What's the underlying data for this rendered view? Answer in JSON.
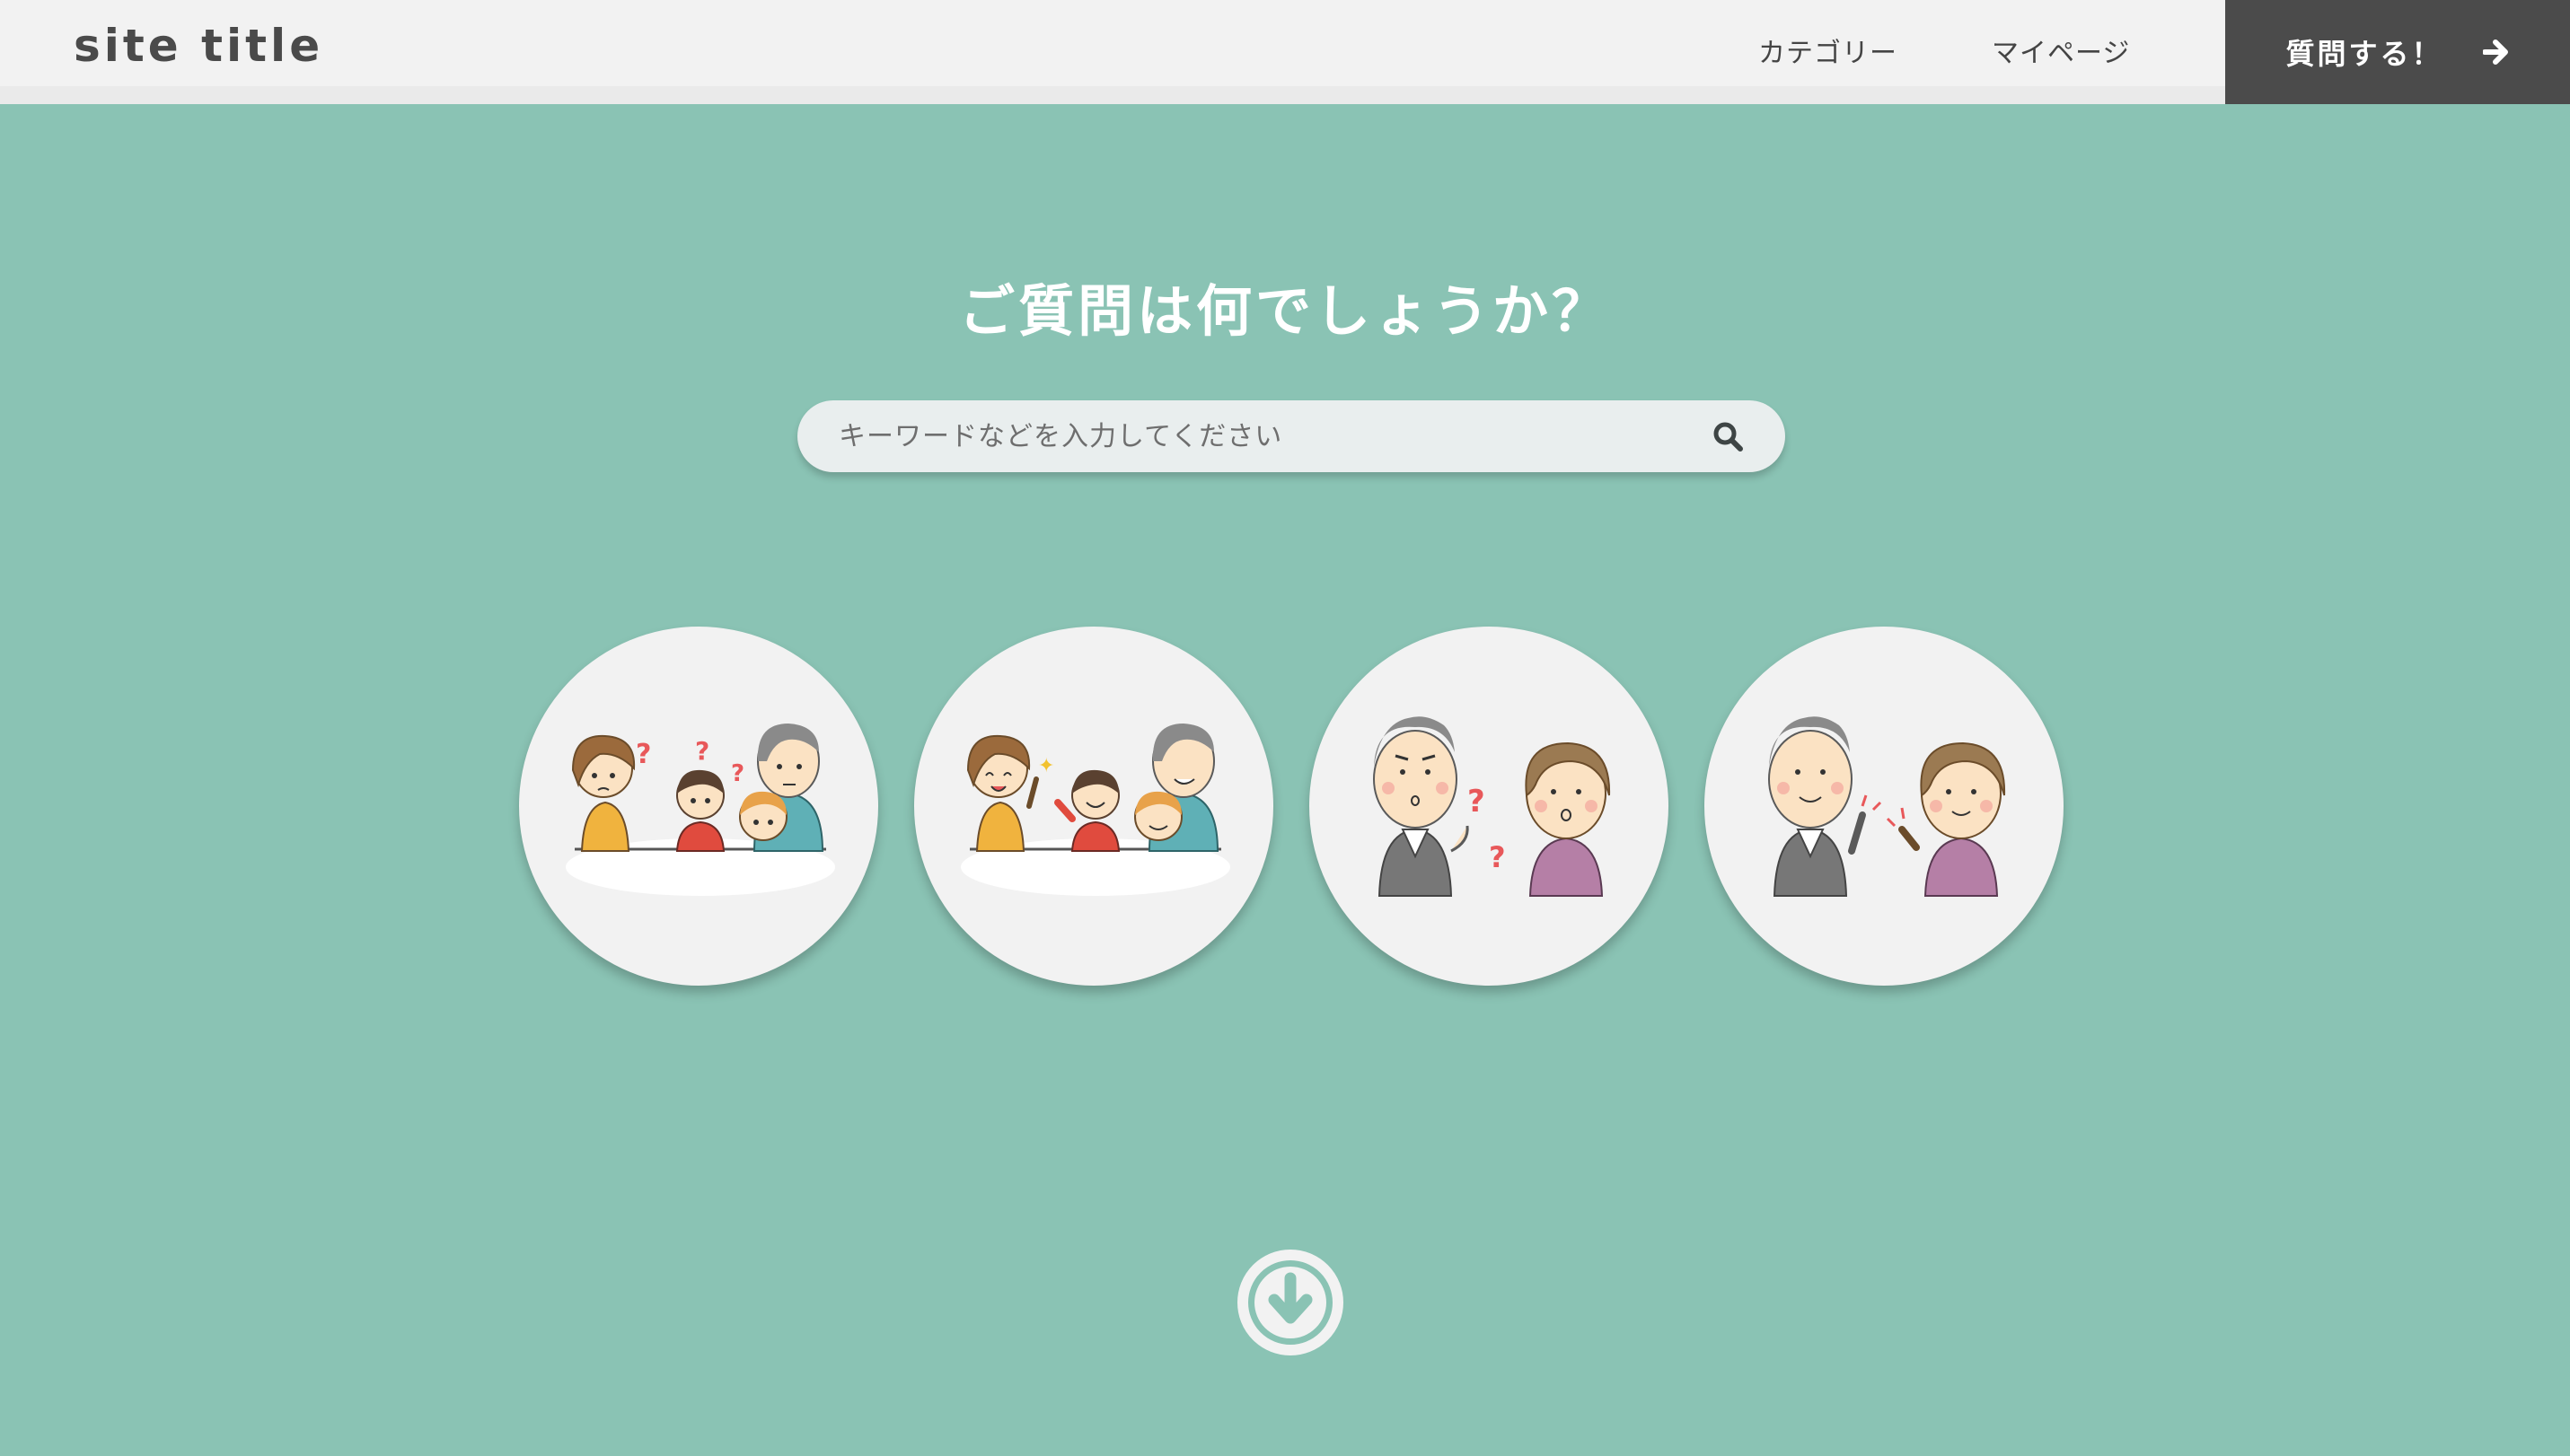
{
  "header": {
    "site_title": "site title",
    "nav": [
      {
        "label": "カテゴリー"
      },
      {
        "label": "マイページ"
      }
    ],
    "cta_label": "質問する！",
    "cta_icon": "arrow-right-icon"
  },
  "hero": {
    "heading": "ご質問は何でしょうか？",
    "search": {
      "placeholder": "キーワードなどを入力してください",
      "value": "",
      "icon": "search-icon"
    }
  },
  "illustrations": [
    {
      "icon": "family-confused-illustration"
    },
    {
      "icon": "family-understanding-illustration"
    },
    {
      "icon": "seniors-confused-illustration"
    },
    {
      "icon": "seniors-understanding-illustration"
    }
  ],
  "scroll_icon": "arrow-down-circle-icon",
  "colors": {
    "background": "#8ac3b4",
    "header": "#f2f2f2",
    "cta": "#4b4b4b",
    "search": "#e9eeee",
    "question_mark": "#e8585a"
  }
}
